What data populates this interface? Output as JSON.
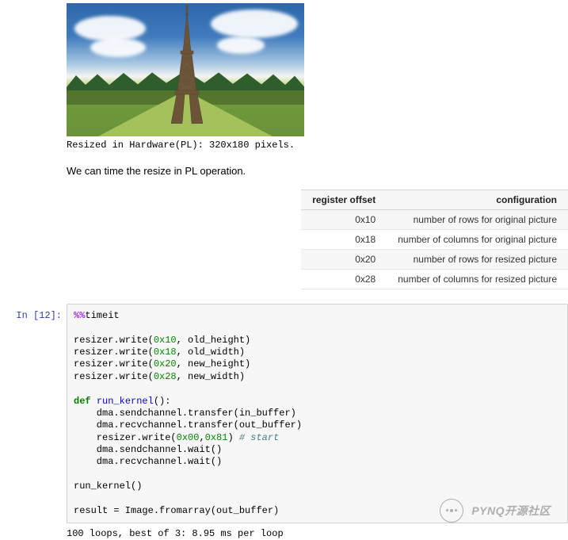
{
  "output": {
    "image_alt": "Eiffel Tower, Paris — resized output",
    "caption": "Resized in Hardware(PL): 320x180 pixels."
  },
  "body_text": "We can time the resize in PL operation.",
  "reg_table": {
    "headers": {
      "offset": "register offset",
      "config": "configuration"
    },
    "rows": [
      {
        "offset": "0x10",
        "config": "number of rows for original picture"
      },
      {
        "offset": "0x18",
        "config": "number of columns for original picture"
      },
      {
        "offset": "0x20",
        "config": "number of rows for resized picture"
      },
      {
        "offset": "0x28",
        "config": "number of columns for resized picture"
      }
    ]
  },
  "cell": {
    "prompt": "In  [12]:",
    "code": {
      "magic_pct": "%%",
      "magic_name": "timeit",
      "l1_a": "resizer.write(",
      "l1_n": "0x10",
      "l1_b": ", old_height)",
      "l2_a": "resizer.write(",
      "l2_n": "0x18",
      "l2_b": ", old_width)",
      "l3_a": "resizer.write(",
      "l3_n": "0x20",
      "l3_b": ", new_height)",
      "l4_a": "resizer.write(",
      "l4_n": "0x28",
      "l4_b": ", new_width)",
      "def_kw": "def",
      "def_sp": " ",
      "def_fn": "run_kernel",
      "def_tail": "():",
      "b1": "    dma.sendchannel.transfer(in_buffer)",
      "b2": "    dma.recvchannel.transfer(out_buffer)",
      "b3_a": "    resizer.write(",
      "b3_n1": "0x00",
      "b3_c": ",",
      "b3_n2": "0x81",
      "b3_b": ") ",
      "b3_cm": "# start",
      "b4": "    dma.sendchannel.wait()",
      "b5": "    dma.recvchannel.wait()",
      "call": "run_kernel()",
      "res": "result = Image.fromarray(out_buffer)"
    },
    "exec_output": "100 loops, best of 3: 8.95 ms per loop"
  },
  "watermark": {
    "text": "PYNQ开源社区"
  }
}
